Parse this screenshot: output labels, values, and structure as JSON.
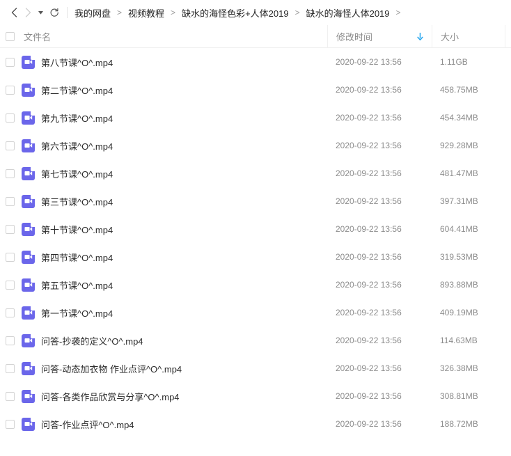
{
  "navbar": {
    "back_icon": "chevron-left-icon",
    "forward_icon": "chevron-right-icon",
    "history_caret_icon": "caret-down-icon",
    "refresh_icon": "refresh-icon",
    "breadcrumb": [
      {
        "label": "我的网盘"
      },
      {
        "label": "视频教程"
      },
      {
        "label": "缺水的海怪色彩+人体2019"
      },
      {
        "label": "缺水的海怪人体2019"
      }
    ],
    "separator": ">"
  },
  "columns": {
    "name": "文件名",
    "time": "修改时间",
    "size": "大小",
    "sort_icon": "arrow-down-icon",
    "sort_color": "#2ba8ef"
  },
  "colors": {
    "file_icon_bg": "#6b66ea",
    "accent": "#2ba8ef",
    "text_primary": "#2b2b2b",
    "text_muted": "#8c8c8c",
    "border": "#f0f0f0"
  },
  "files": [
    {
      "name": "第八节课^O^.mp4",
      "time": "2020-09-22 13:56",
      "size": "1.11GB",
      "icon": "video-file-icon"
    },
    {
      "name": "第二节课^O^.mp4",
      "time": "2020-09-22 13:56",
      "size": "458.75MB",
      "icon": "video-file-icon"
    },
    {
      "name": "第九节课^O^.mp4",
      "time": "2020-09-22 13:56",
      "size": "454.34MB",
      "icon": "video-file-icon"
    },
    {
      "name": "第六节课^O^.mp4",
      "time": "2020-09-22 13:56",
      "size": "929.28MB",
      "icon": "video-file-icon"
    },
    {
      "name": "第七节课^O^.mp4",
      "time": "2020-09-22 13:56",
      "size": "481.47MB",
      "icon": "video-file-icon"
    },
    {
      "name": "第三节课^O^.mp4",
      "time": "2020-09-22 13:56",
      "size": "397.31MB",
      "icon": "video-file-icon"
    },
    {
      "name": "第十节课^O^.mp4",
      "time": "2020-09-22 13:56",
      "size": "604.41MB",
      "icon": "video-file-icon"
    },
    {
      "name": "第四节课^O^.mp4",
      "time": "2020-09-22 13:56",
      "size": "319.53MB",
      "icon": "video-file-icon"
    },
    {
      "name": "第五节课^O^.mp4",
      "time": "2020-09-22 13:56",
      "size": "893.88MB",
      "icon": "video-file-icon"
    },
    {
      "name": "第一节课^O^.mp4",
      "time": "2020-09-22 13:56",
      "size": "409.19MB",
      "icon": "video-file-icon"
    },
    {
      "name": "问答-抄袭的定义^O^.mp4",
      "time": "2020-09-22 13:56",
      "size": "114.63MB",
      "icon": "video-file-icon"
    },
    {
      "name": "问答-动态加衣物 作业点评^O^.mp4",
      "time": "2020-09-22 13:56",
      "size": "326.38MB",
      "icon": "video-file-icon"
    },
    {
      "name": "问答-各类作品欣赏与分享^O^.mp4",
      "time": "2020-09-22 13:56",
      "size": "308.81MB",
      "icon": "video-file-icon"
    },
    {
      "name": "问答-作业点评^O^.mp4",
      "time": "2020-09-22 13:56",
      "size": "188.72MB",
      "icon": "video-file-icon"
    }
  ]
}
